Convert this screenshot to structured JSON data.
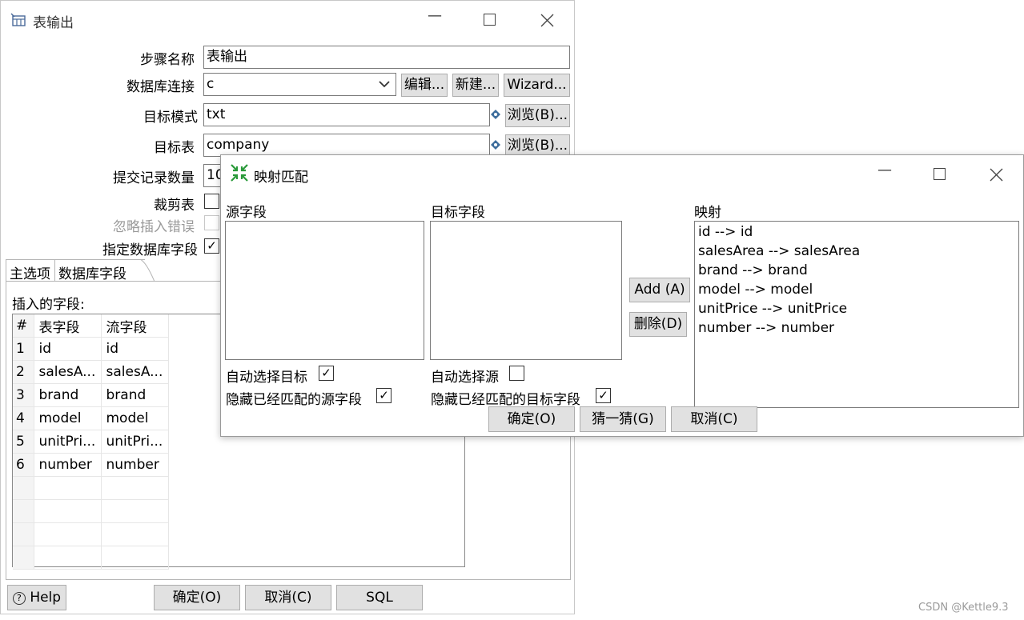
{
  "main_window": {
    "title": "表输出",
    "labels": {
      "step_name": "步骤名称",
      "db_connection": "数据库连接",
      "target_schema": "目标模式",
      "target_table": "目标表",
      "commit_size": "提交记录数量",
      "truncate": "裁剪表",
      "ignore_errors": "忽略插入错误",
      "specify_fields": "指定数据库字段"
    },
    "values": {
      "step_name": "表输出",
      "db_connection": "c",
      "target_schema": "txt",
      "target_table": "company",
      "commit_size": "10"
    },
    "checkboxes": {
      "truncate": false,
      "ignore_errors": false,
      "specify_fields": true
    },
    "buttons": {
      "edit": "编辑...",
      "new": "新建...",
      "wizard": "Wizard...",
      "browse_schema": "浏览(B)...",
      "browse_table": "浏览(B)...",
      "help": "Help",
      "ok": "确定(O)",
      "cancel": "取消(C)",
      "sql": "SQL"
    },
    "tabs": [
      "主选项",
      "数据库字段"
    ],
    "fields_label": "插入的字段:",
    "table": {
      "headers": [
        "#",
        "表字段",
        "流字段"
      ],
      "rows": [
        [
          "1",
          "id",
          "id"
        ],
        [
          "2",
          "salesA...",
          "salesA..."
        ],
        [
          "3",
          "brand",
          "brand"
        ],
        [
          "4",
          "model",
          "model"
        ],
        [
          "5",
          "unitPri...",
          "unitPri..."
        ],
        [
          "6",
          "number",
          "number"
        ]
      ]
    }
  },
  "mapping_dialog": {
    "title": "映射匹配",
    "source_label": "源字段",
    "target_label": "目标字段",
    "mapping_label": "映射",
    "mappings": [
      "id --> id",
      "salesArea --> salesArea",
      "brand --> brand",
      "model --> model",
      "unitPrice --> unitPrice",
      "number --> number"
    ],
    "auto_target": "自动选择目标",
    "hide_source": "隐藏已经匹配的源字段",
    "auto_source": "自动选择源",
    "hide_target": "隐藏已经匹配的目标字段",
    "checks": {
      "auto_target": true,
      "hide_source": true,
      "auto_source": false,
      "hide_target": true
    },
    "buttons": {
      "add": "Add (A)",
      "delete": "删除(D)",
      "ok": "确定(O)",
      "guess": "猜一猜(G)",
      "cancel": "取消(C)"
    }
  },
  "watermark": "CSDN @Kettle9.3"
}
